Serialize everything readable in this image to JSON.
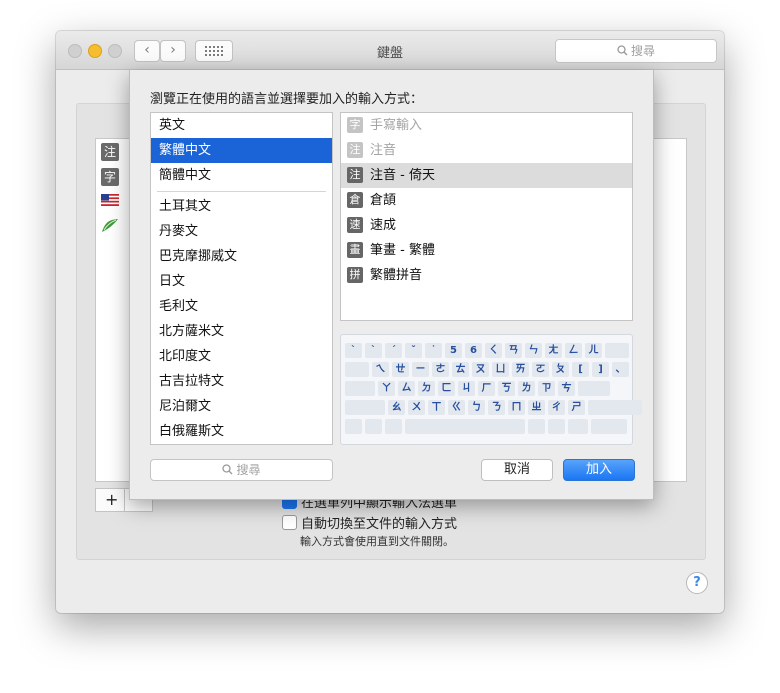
{
  "window": {
    "title": "鍵盤",
    "search_placeholder": "搜尋",
    "back_glyph": "‹",
    "forward_glyph": "›"
  },
  "background": {
    "list_badges": [
      "注",
      "字"
    ],
    "plus_label": "+",
    "checkbox_1_label": "在選單列中顯示輸入法選單",
    "checkbox_2_label": "自動切換至文件的輸入方式",
    "note": "輸入方式會使用直到文件關閉。",
    "help_label": "?"
  },
  "sheet": {
    "prompt": "瀏覽正在使用的語言並選擇要加入的輸入方式：",
    "languages": [
      {
        "label": "英文",
        "selected": false
      },
      {
        "label": "繁體中文",
        "selected": true
      },
      {
        "label": "簡體中文",
        "selected": false
      },
      {
        "label": "土耳其文",
        "selected": false
      },
      {
        "label": "丹麥文",
        "selected": false
      },
      {
        "label": "巴克摩挪威文",
        "selected": false
      },
      {
        "label": "日文",
        "selected": false
      },
      {
        "label": "毛利文",
        "selected": false
      },
      {
        "label": "北方薩米文",
        "selected": false
      },
      {
        "label": "北印度文",
        "selected": false
      },
      {
        "label": "古吉拉特文",
        "selected": false
      },
      {
        "label": "尼泊爾文",
        "selected": false
      },
      {
        "label": "白俄羅斯文",
        "selected": false
      }
    ],
    "methods": [
      {
        "badge": "字",
        "label": "手寫輸入",
        "state": "disabled"
      },
      {
        "badge": "注",
        "label": "注音",
        "state": "disabled"
      },
      {
        "badge": "注",
        "label": "注音 - 倚天",
        "state": "selected"
      },
      {
        "badge": "倉",
        "label": "倉頡",
        "state": "normal"
      },
      {
        "badge": "速",
        "label": "速成",
        "state": "normal"
      },
      {
        "badge": "畫",
        "label": "筆畫 - 繁體",
        "state": "normal"
      },
      {
        "badge": "拼",
        "label": "繁體拼音",
        "state": "normal"
      }
    ],
    "keyboard_rows": [
      [
        "`",
        "ˋ",
        "ˊ",
        "ˇ",
        "˙",
        "5",
        "6",
        "ㄑ",
        "ㄢ",
        "ㄣ",
        "ㄤ",
        "ㄥ",
        "ㄦ",
        ""
      ],
      [
        "",
        "ㄟ",
        "ㄝ",
        "ㄧ",
        "ㄜ",
        "ㄊ",
        "ㄡ",
        "ㄩ",
        "ㄞ",
        "ㄛ",
        "ㄆ",
        "[",
        "]",
        "、"
      ],
      [
        "",
        "ㄚ",
        "ㄙ",
        "ㄉ",
        "ㄈ",
        "ㄐ",
        "ㄏ",
        "ㄎ",
        "ㄌ",
        "ㄗ",
        "ㄘ",
        ""
      ],
      [
        "",
        "ㄠ",
        "ㄨ",
        "ㄒ",
        "ㄍ",
        "ㄅ",
        "ㄋ",
        "ㄇ",
        "ㄓ",
        "ㄔ",
        "ㄕ",
        ""
      ]
    ],
    "search_placeholder": "搜尋",
    "cancel_label": "取消",
    "add_label": "加入"
  },
  "colors": {
    "selection_blue": "#1a64d7",
    "add_button_blue": "#1a76f3",
    "keyboard_key_text": "#274f9e"
  }
}
